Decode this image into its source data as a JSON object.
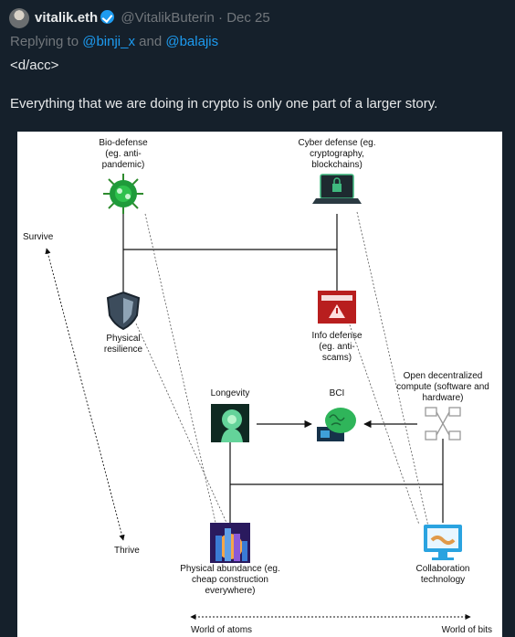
{
  "tweet": {
    "author_name": "vitalik.eth",
    "handle": "@VitalikButerin",
    "separator": "·",
    "date": "Dec 25",
    "reply_prefix": "Replying to",
    "reply_user1": "@binji_x",
    "reply_and": "and",
    "reply_user2": "@balajis",
    "text_line1": "<d/acc>",
    "text_line2": "Everything that we are doing in crypto is only one part of a larger story."
  },
  "diagram": {
    "nodes": {
      "bio_defense": "Bio-defense (eg. anti-pandemic)",
      "cyber_defense": "Cyber defense (eg. cryptography, blockchains)",
      "physical_resilience": "Physical resilience",
      "info_defense": "Info defense (eg. anti-scams)",
      "longevity": "Longevity",
      "bci": "BCI",
      "open_compute": "Open decentralized compute (software and hardware)",
      "physical_abundance": "Physical abundance (eg. cheap construction everywhere)",
      "collaboration": "Collaboration technology"
    },
    "axes": {
      "survive": "Survive",
      "thrive": "Thrive",
      "world_of_atoms": "World of atoms",
      "world_of_bits": "World of bits"
    }
  },
  "icons": {
    "verified": "verified-badge-icon",
    "virus": "virus-icon",
    "laptop": "laptop-lock-icon",
    "shield": "shield-icon",
    "alert": "alert-screen-icon",
    "head": "head-profile-icon",
    "brain": "brain-chip-icon",
    "network": "network-computers-icon",
    "city": "city-icon",
    "handshake": "handshake-monitor-icon"
  },
  "colors": {
    "background": "#15202b",
    "link": "#1d9bf0",
    "muted": "#71767b",
    "text": "#e7e9ea"
  }
}
